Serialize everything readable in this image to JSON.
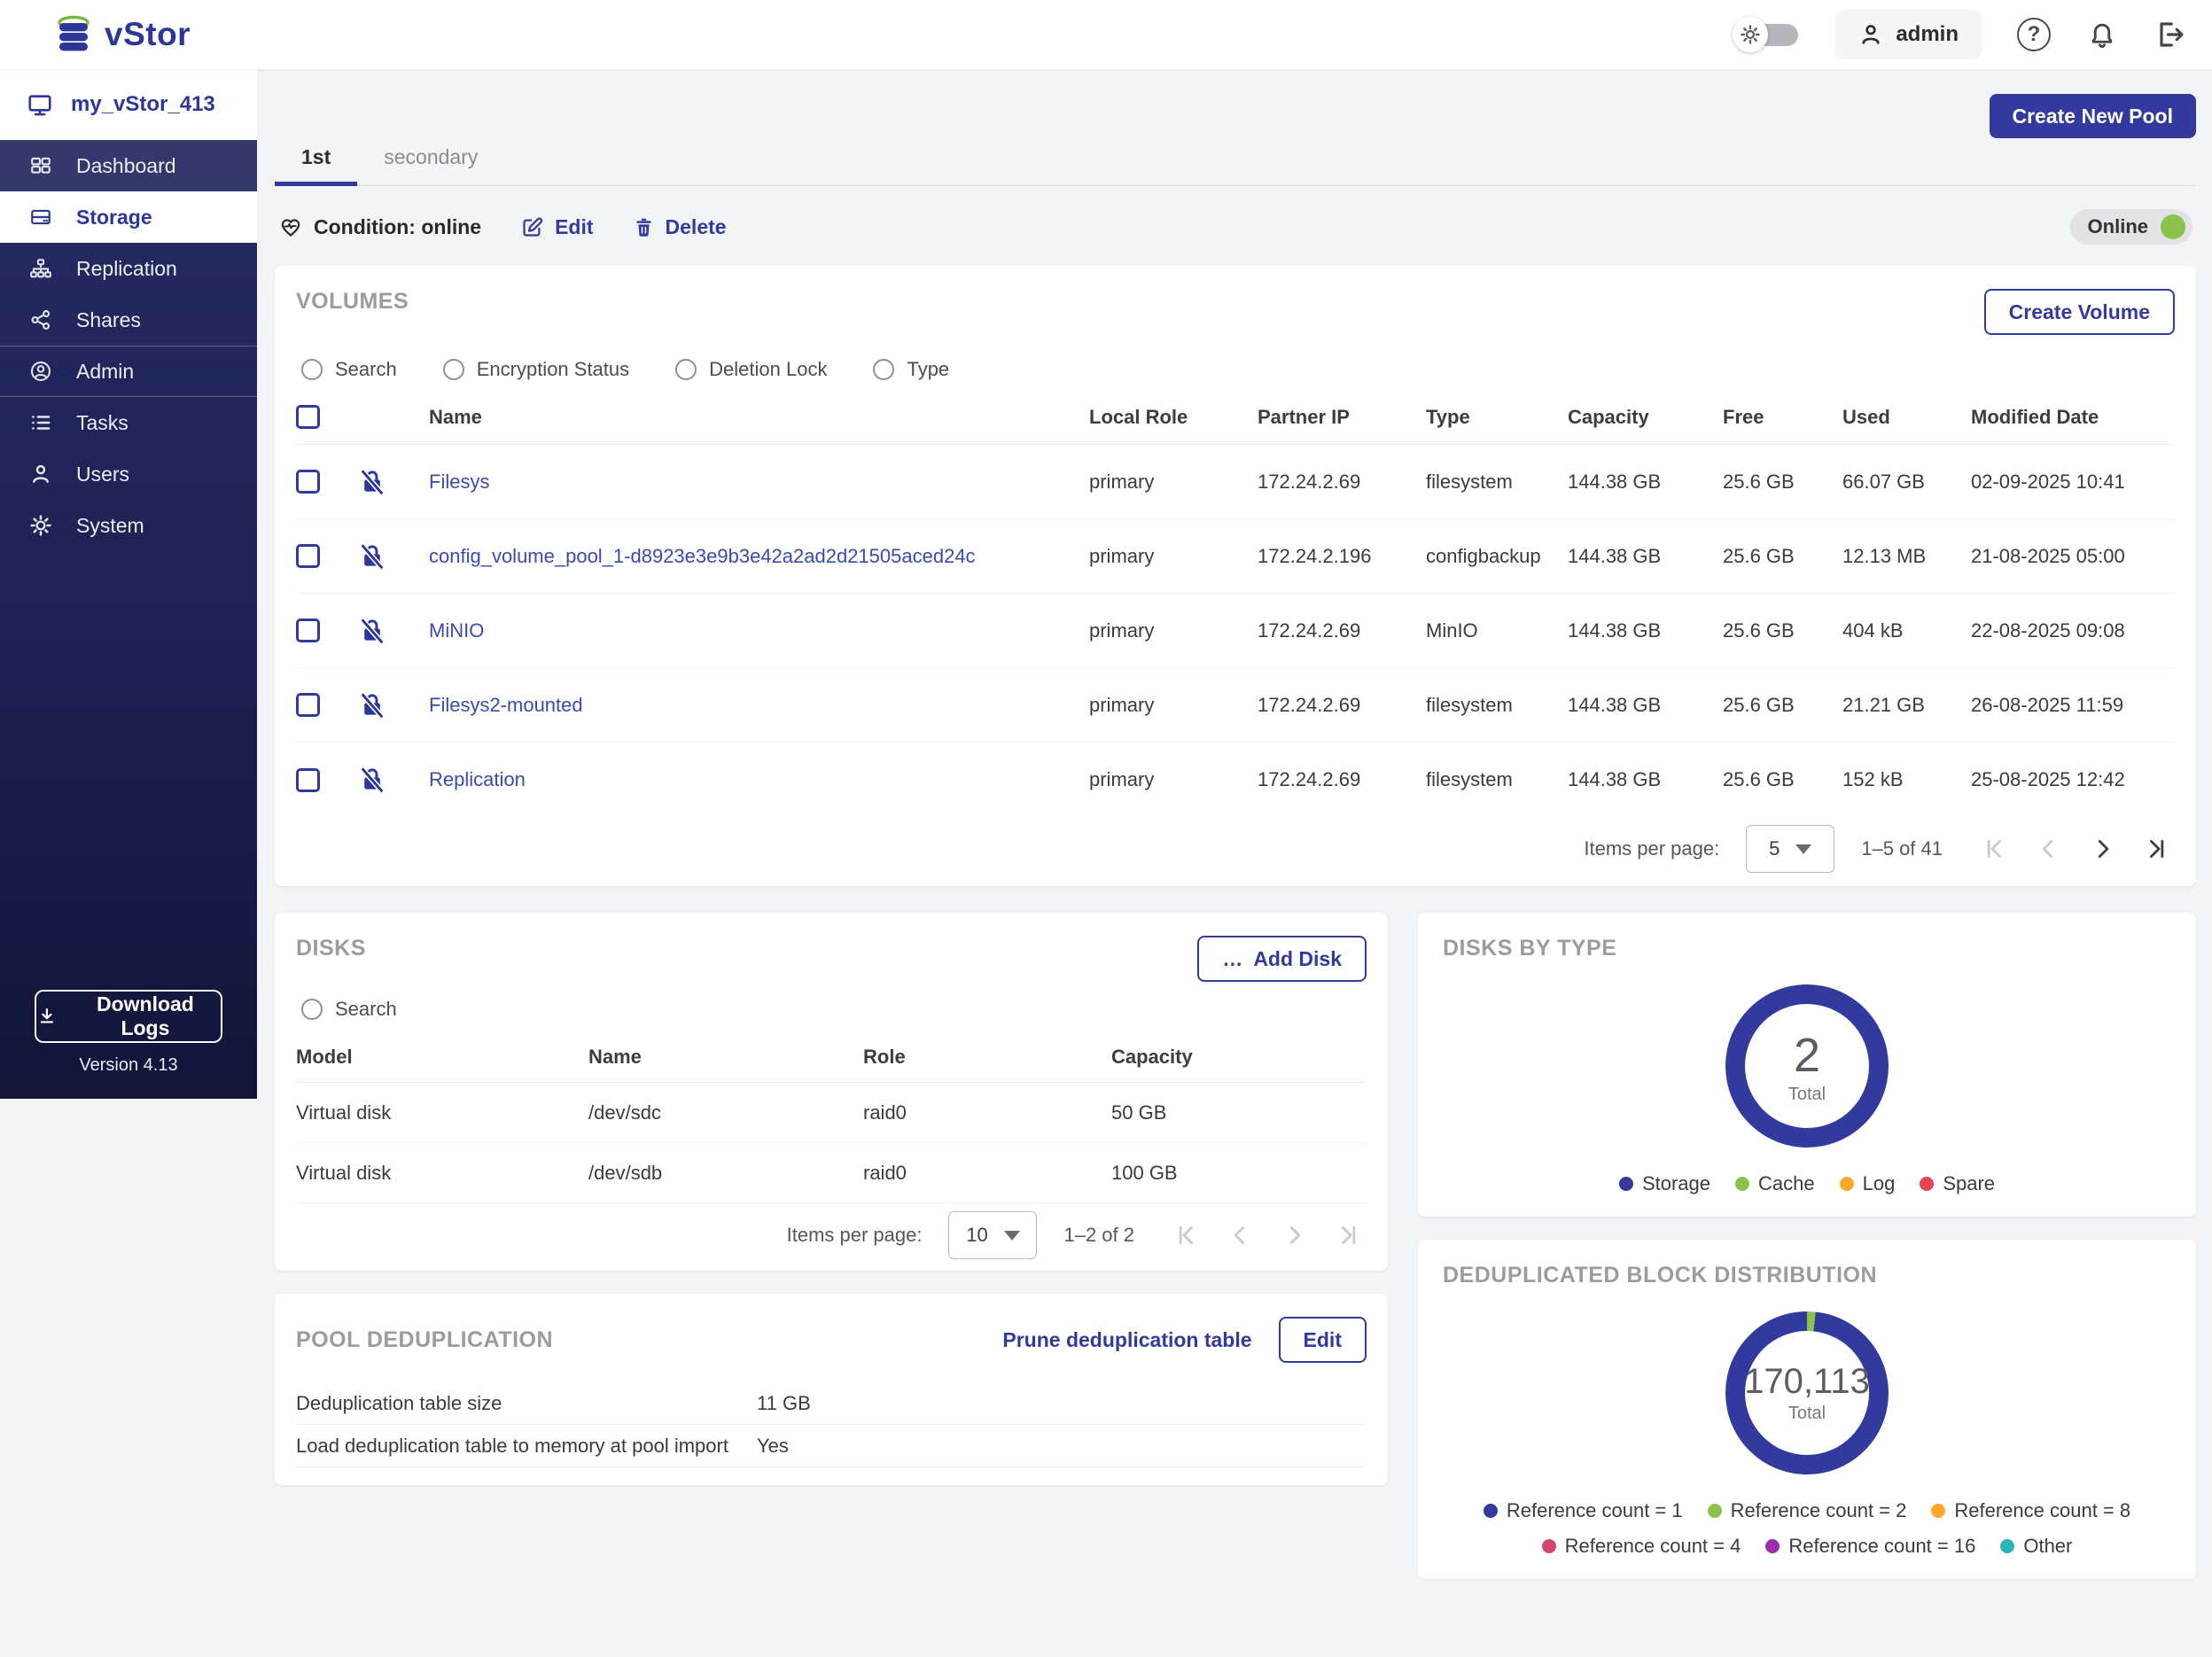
{
  "colors": {
    "accent": "#333a9e",
    "navy": "#1d2153",
    "link": "#3a4ab0",
    "green": "#8bc34a",
    "orange": "#ffa726",
    "red": "#e8415a",
    "crimson": "#d1476e",
    "purple": "#9b2fae",
    "teal": "#2cb5b9"
  },
  "header": {
    "logo": "vStor",
    "user": "admin"
  },
  "sidebar": {
    "system_name": "my_vStor_413",
    "items": [
      {
        "label": "Dashboard"
      },
      {
        "label": "Storage"
      },
      {
        "label": "Replication"
      },
      {
        "label": "Shares"
      },
      {
        "label": "Admin"
      },
      {
        "label": "Tasks"
      },
      {
        "label": "Users"
      },
      {
        "label": "System"
      }
    ],
    "download_logs": "Download Logs",
    "version": "Version 4.13"
  },
  "pool_header": {
    "create_new_pool": "Create New Pool",
    "tabs": [
      {
        "label": "1st"
      },
      {
        "label": "secondary"
      }
    ],
    "condition_label": "Condition: online",
    "edit": "Edit",
    "delete": "Delete",
    "status": "Online"
  },
  "volumes": {
    "title": "VOLUMES",
    "create_volume": "Create Volume",
    "filters": [
      {
        "label": "Search"
      },
      {
        "label": "Encryption Status"
      },
      {
        "label": "Deletion Lock"
      },
      {
        "label": "Type"
      }
    ],
    "columns": {
      "name": "Name",
      "local_role": "Local Role",
      "partner_ip": "Partner IP",
      "type": "Type",
      "capacity": "Capacity",
      "free": "Free",
      "used": "Used",
      "modified": "Modified Date"
    },
    "rows": [
      {
        "name": "Filesys",
        "local_role": "primary",
        "partner_ip": "172.24.2.69",
        "type": "filesystem",
        "capacity": "144.38 GB",
        "free": "25.6 GB",
        "used": "66.07 GB",
        "modified": "02-09-2025 10:41"
      },
      {
        "name": "config_volume_pool_1-d8923e3e9b3e42a2ad2d21505aced24c",
        "local_role": "primary",
        "partner_ip": "172.24.2.196",
        "type": "configbackup",
        "capacity": "144.38 GB",
        "free": "25.6 GB",
        "used": "12.13 MB",
        "modified": "21-08-2025 05:00"
      },
      {
        "name": "MiNIO",
        "local_role": "primary",
        "partner_ip": "172.24.2.69",
        "type": "MinIO",
        "capacity": "144.38 GB",
        "free": "25.6 GB",
        "used": "404 kB",
        "modified": "22-08-2025 09:08"
      },
      {
        "name": "Filesys2-mounted",
        "local_role": "primary",
        "partner_ip": "172.24.2.69",
        "type": "filesystem",
        "capacity": "144.38 GB",
        "free": "25.6 GB",
        "used": "21.21 GB",
        "modified": "26-08-2025 11:59"
      },
      {
        "name": "Replication",
        "local_role": "primary",
        "partner_ip": "172.24.2.69",
        "type": "filesystem",
        "capacity": "144.38 GB",
        "free": "25.6 GB",
        "used": "152 kB",
        "modified": "25-08-2025 12:42"
      }
    ],
    "pagination": {
      "label": "Items per page:",
      "per_page": "5",
      "range": "1–5 of 41"
    }
  },
  "disks": {
    "title": "DISKS",
    "add_disk": "Add Disk",
    "add_disk_icon": "…",
    "search": "Search",
    "columns": {
      "model": "Model",
      "name": "Name",
      "role": "Role",
      "capacity": "Capacity"
    },
    "rows": [
      {
        "model": "Virtual disk",
        "name": "/dev/sdc",
        "role": "raid0",
        "capacity": "50 GB"
      },
      {
        "model": "Virtual disk",
        "name": "/dev/sdb",
        "role": "raid0",
        "capacity": "100 GB"
      }
    ],
    "pagination": {
      "label": "Items per page:",
      "per_page": "10",
      "range": "1–2 of 2"
    }
  },
  "disks_by_type": {
    "title": "DISKS BY TYPE",
    "total": "2",
    "total_label": "Total",
    "legend": [
      {
        "label": "Storage",
        "color": "#333a9e"
      },
      {
        "label": "Cache",
        "color": "#8bc34a"
      },
      {
        "label": "Log",
        "color": "#ffa726"
      },
      {
        "label": "Spare",
        "color": "#e8415a"
      }
    ],
    "segments": [
      {
        "label": "Storage",
        "pct": 100,
        "color": "#333a9e"
      }
    ]
  },
  "pool_dedup": {
    "title": "POOL DEDUPLICATION",
    "prune": "Prune deduplication table",
    "edit": "Edit",
    "rows": [
      {
        "label": "Deduplication table size",
        "value": "11 GB"
      },
      {
        "label": "Load deduplication table to memory at pool import",
        "value": "Yes"
      }
    ]
  },
  "dedup_distribution": {
    "title": "DEDUPLICATED BLOCK DISTRIBUTION",
    "total": "170,113",
    "total_label": "Total",
    "legend": [
      {
        "label": "Reference count = 1",
        "color": "#333a9e"
      },
      {
        "label": "Reference count = 2",
        "color": "#8bc34a"
      },
      {
        "label": "Reference count = 8",
        "color": "#ffa726"
      },
      {
        "label": "Reference count = 4",
        "color": "#d1476e"
      },
      {
        "label": "Reference count = 16",
        "color": "#9b2fae"
      },
      {
        "label": "Other",
        "color": "#2cb5b9"
      }
    ],
    "segments": [
      {
        "label": "Reference count = 2",
        "pct": 1.7,
        "color": "#8bc34a"
      },
      {
        "label": "Reference count = 1",
        "pct": 98.3,
        "color": "#333a9e"
      }
    ]
  },
  "chart_data": [
    {
      "type": "pie",
      "title": "DISKS BY TYPE",
      "labels": [
        "Storage",
        "Cache",
        "Log",
        "Spare"
      ],
      "values": [
        2,
        0,
        0,
        0
      ],
      "total": 2,
      "center_label": "Total",
      "legend_position": "bottom"
    },
    {
      "type": "pie",
      "title": "DEDUPLICATED BLOCK DISTRIBUTION",
      "labels": [
        "Reference count = 1",
        "Reference count = 2",
        "Reference count = 8",
        "Reference count = 4",
        "Reference count = 16",
        "Other"
      ],
      "values_pct_estimated": [
        98.3,
        1.7,
        0,
        0,
        0,
        0
      ],
      "total": 170113,
      "center_label": "Total",
      "legend_position": "bottom"
    }
  ]
}
